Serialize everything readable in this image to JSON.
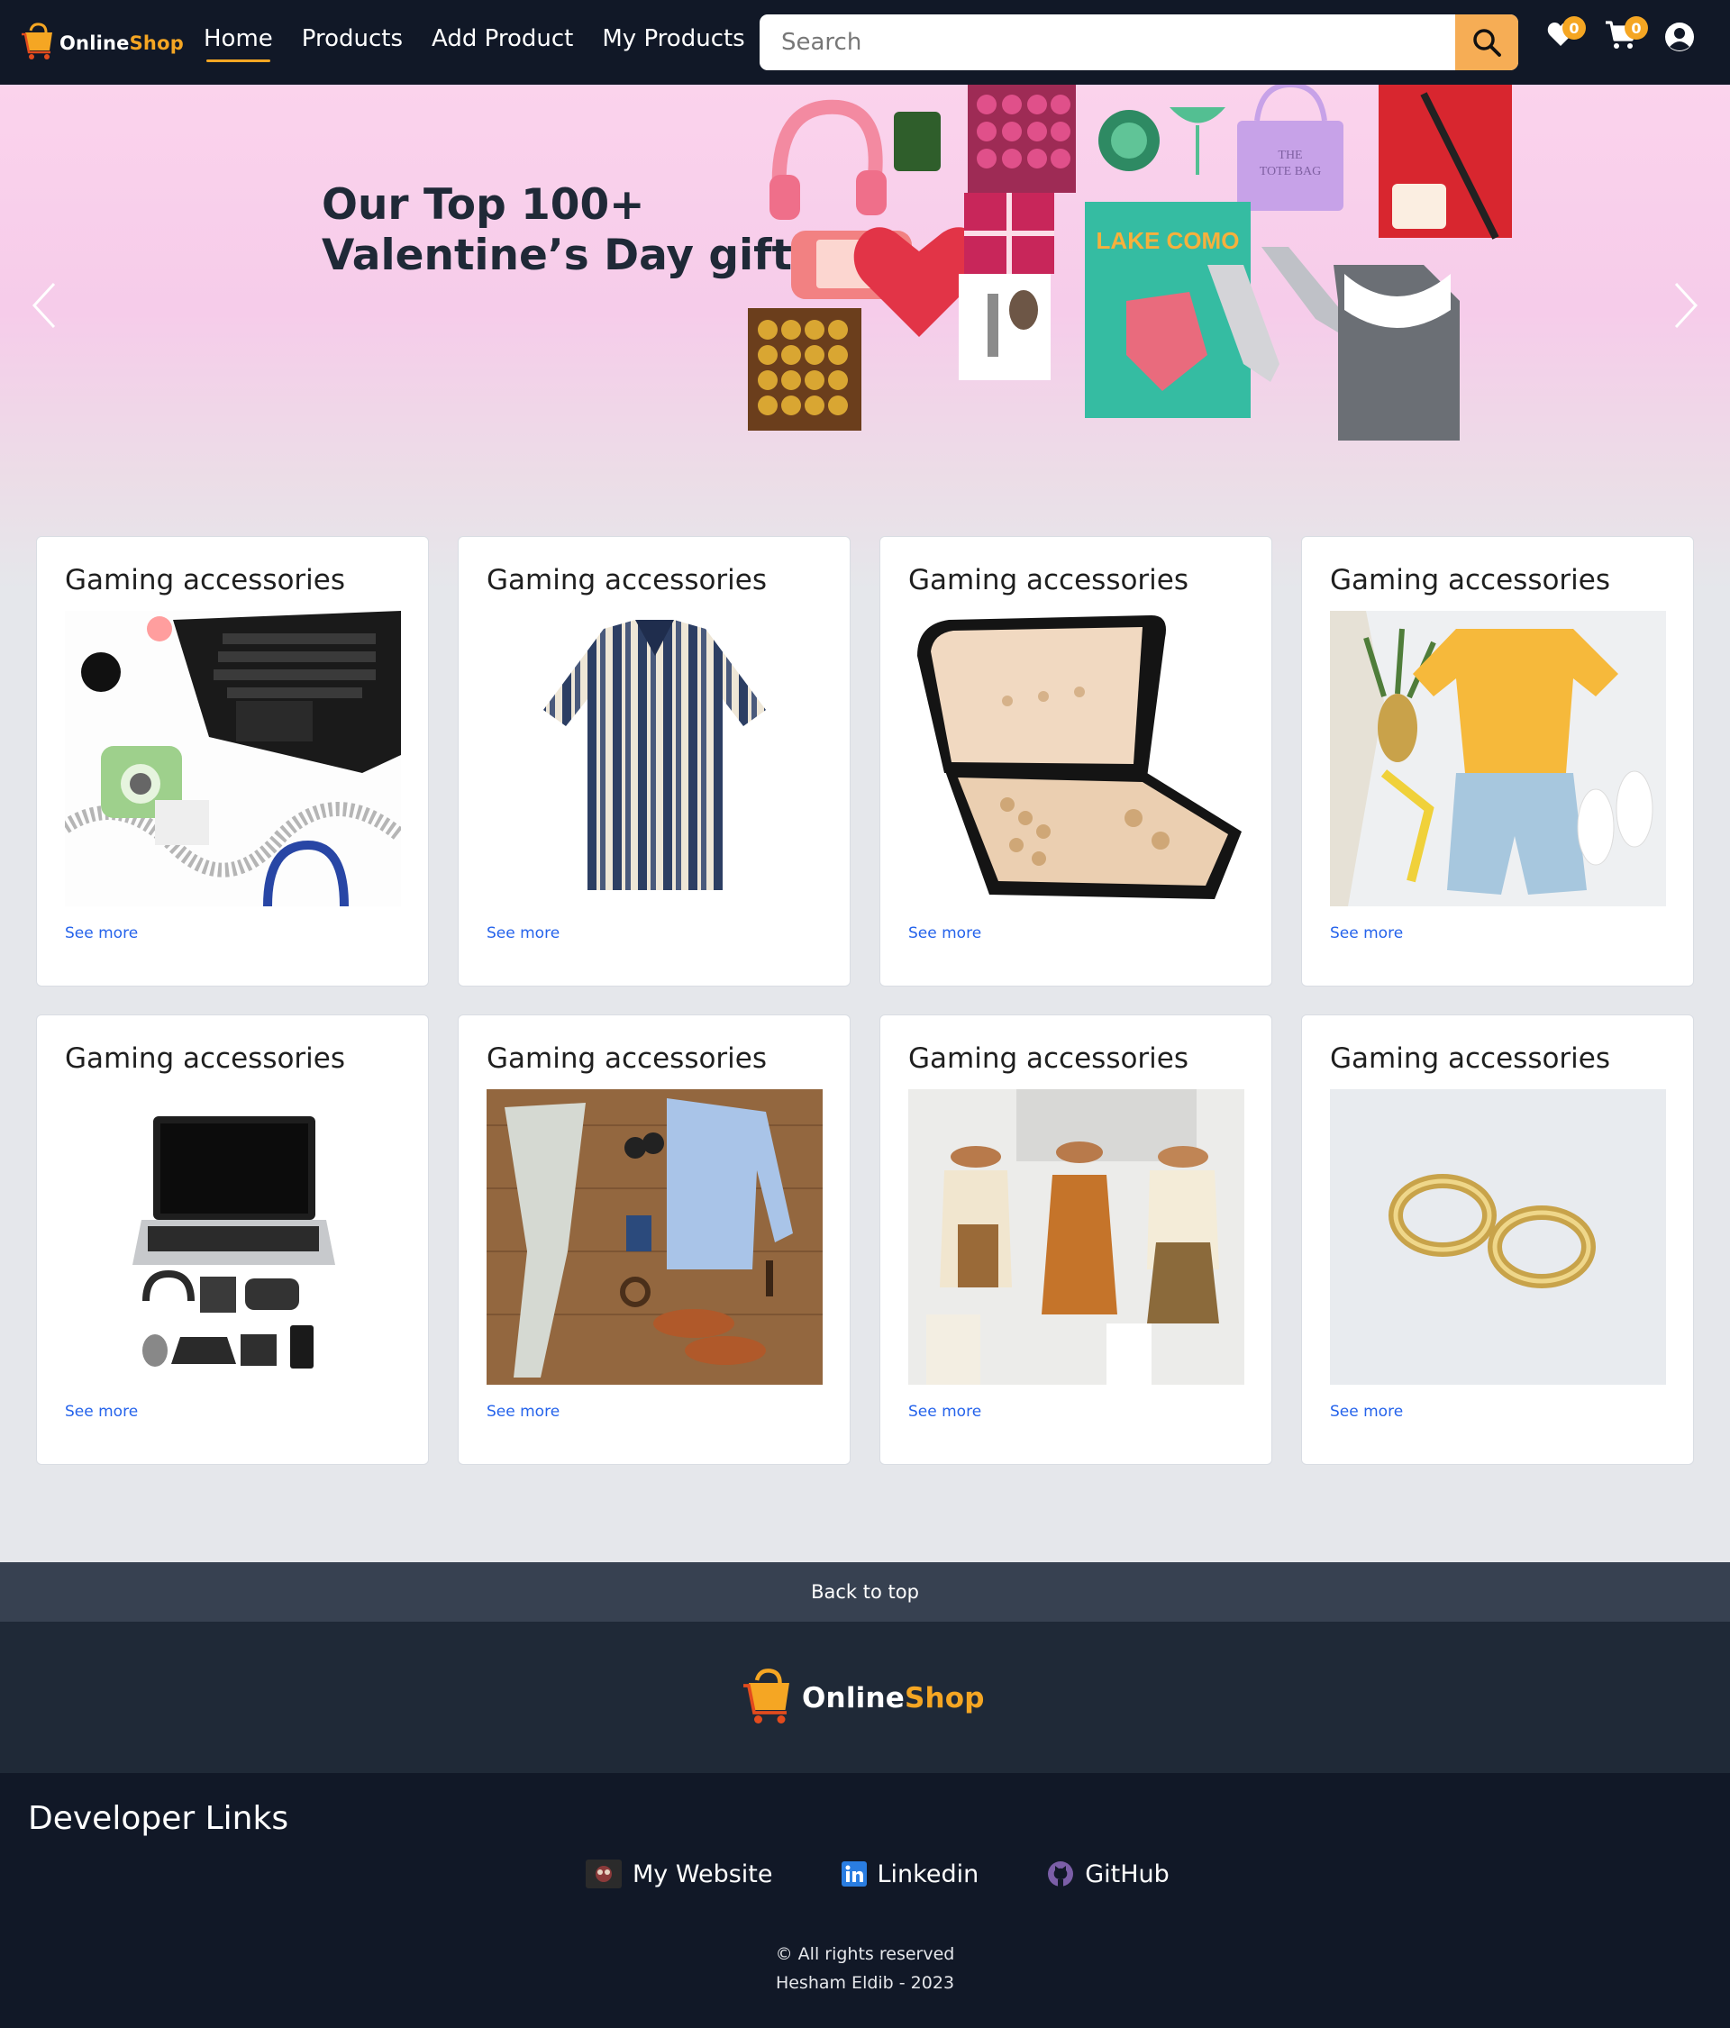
{
  "brand": {
    "part1": "Online",
    "part2": "Shop"
  },
  "nav": {
    "links": [
      "Home",
      "Products",
      "Add Product",
      "My Products"
    ],
    "active": "Home",
    "search_placeholder": "Search",
    "wishlist_count": "0",
    "cart_count": "0",
    "icons": [
      "search-icon",
      "heart-icon",
      "cart-icon",
      "user-icon"
    ]
  },
  "hero": {
    "title_line1": "Our Top 100+",
    "title_line2": "Valentine’s Day gifts",
    "collage_texts": {
      "tote": "THE TOTE BAG",
      "book": "LAKE COMO"
    },
    "arrows": [
      "chevron-left-icon",
      "chevron-right-icon"
    ]
  },
  "cards": [
    {
      "title": "Gaming accessories",
      "link": "See more",
      "image": "laptop-flatlay"
    },
    {
      "title": "Gaming accessories",
      "link": "See more",
      "image": "striped-shirt"
    },
    {
      "title": "Gaming accessories",
      "link": "See more",
      "image": "jewelry-box"
    },
    {
      "title": "Gaming accessories",
      "link": "See more",
      "image": "summer-outfit"
    },
    {
      "title": "Gaming accessories",
      "link": "See more",
      "image": "laptop-gadgets"
    },
    {
      "title": "Gaming accessories",
      "link": "See more",
      "image": "mens-outfit"
    },
    {
      "title": "Gaming accessories",
      "link": "See more",
      "image": "mannequins"
    },
    {
      "title": "Gaming accessories",
      "link": "See more",
      "image": "gold-earrings"
    }
  ],
  "footer": {
    "back_to_top": "Back to top",
    "dev_title": "Developer Links",
    "links": [
      {
        "label": "My Website",
        "icon": "website-avatar-icon"
      },
      {
        "label": "Linkedin",
        "icon": "linkedin-icon"
      },
      {
        "label": "GitHub",
        "icon": "github-icon"
      }
    ],
    "copyright": "© All rights reserved",
    "author": "Hesham Eldib - 2023"
  },
  "colors": {
    "navbar": "#111827",
    "accent": "#f5a623",
    "link": "#2563eb",
    "footer": "#111827"
  }
}
